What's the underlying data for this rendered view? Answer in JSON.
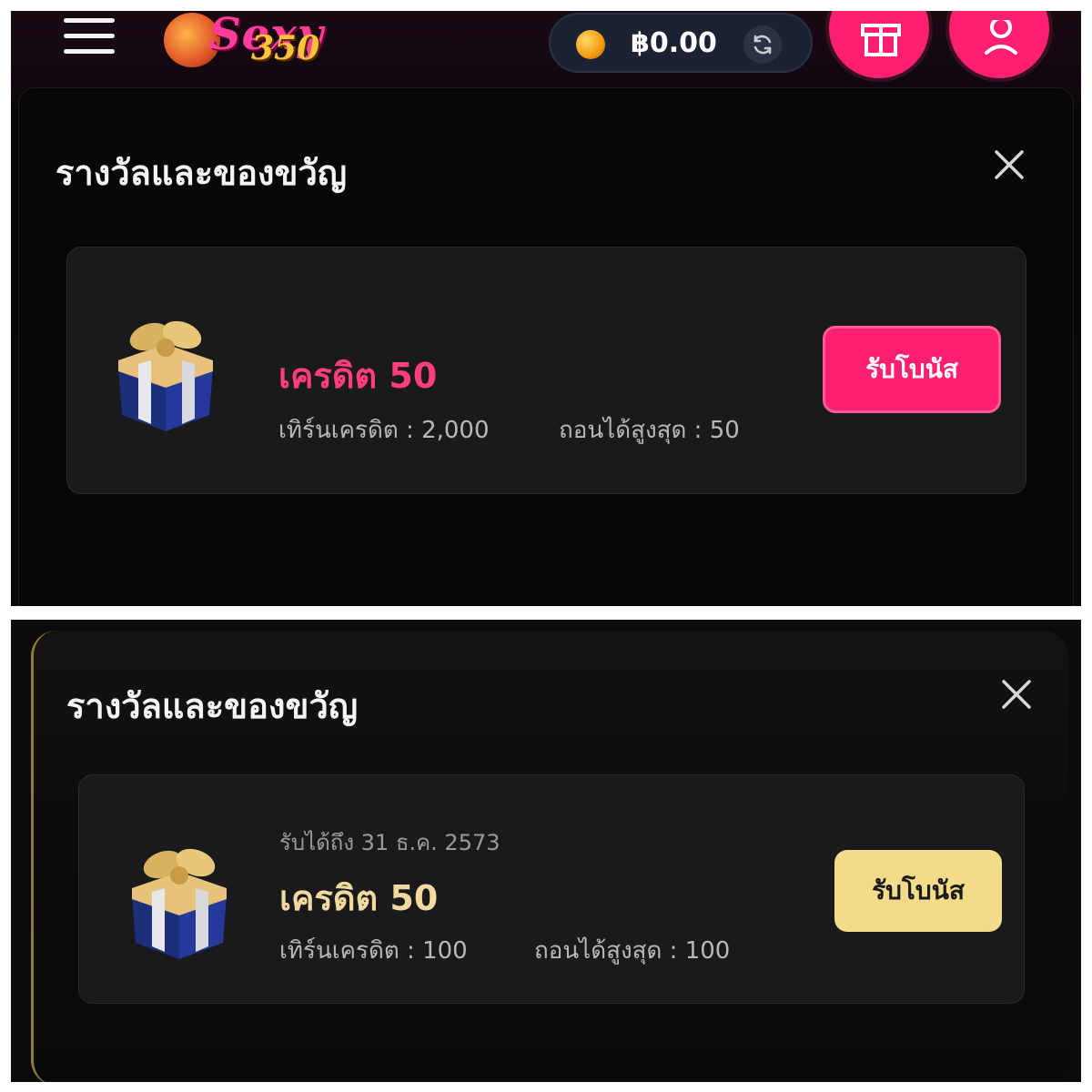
{
  "header": {
    "logo_word": "Sexy",
    "logo_number": "350",
    "balance": "฿0.00"
  },
  "screens": [
    {
      "title": "รางวัลและของขวัญ",
      "reward": {
        "expiry": "",
        "name": "เครดิต 50",
        "turnover": "เทิร์นเครดิต : 2,000",
        "max_withdraw": "ถอนได้สูงสุด : 50",
        "claim_label": "รับโบนัส"
      }
    },
    {
      "title": "รางวัลและของขวัญ",
      "reward": {
        "expiry": "รับได้ถึง 31 ธ.ค. 2573",
        "name": "เครดิต 50",
        "turnover": "เทิร์นเครดิต : 100",
        "max_withdraw": "ถอนได้สูงสุด : 100",
        "claim_label": "รับโบนัส"
      }
    }
  ],
  "colors": {
    "accent_pink": "#ff1f6f",
    "accent_gold": "#f2dc8a",
    "title_pink": "#ff3d7f",
    "title_gold": "#f2d9a0"
  },
  "icons": [
    "menu-icon",
    "coin-icon",
    "refresh-icon",
    "gift-icon",
    "user-icon",
    "close-icon",
    "gift-box-icon"
  ]
}
